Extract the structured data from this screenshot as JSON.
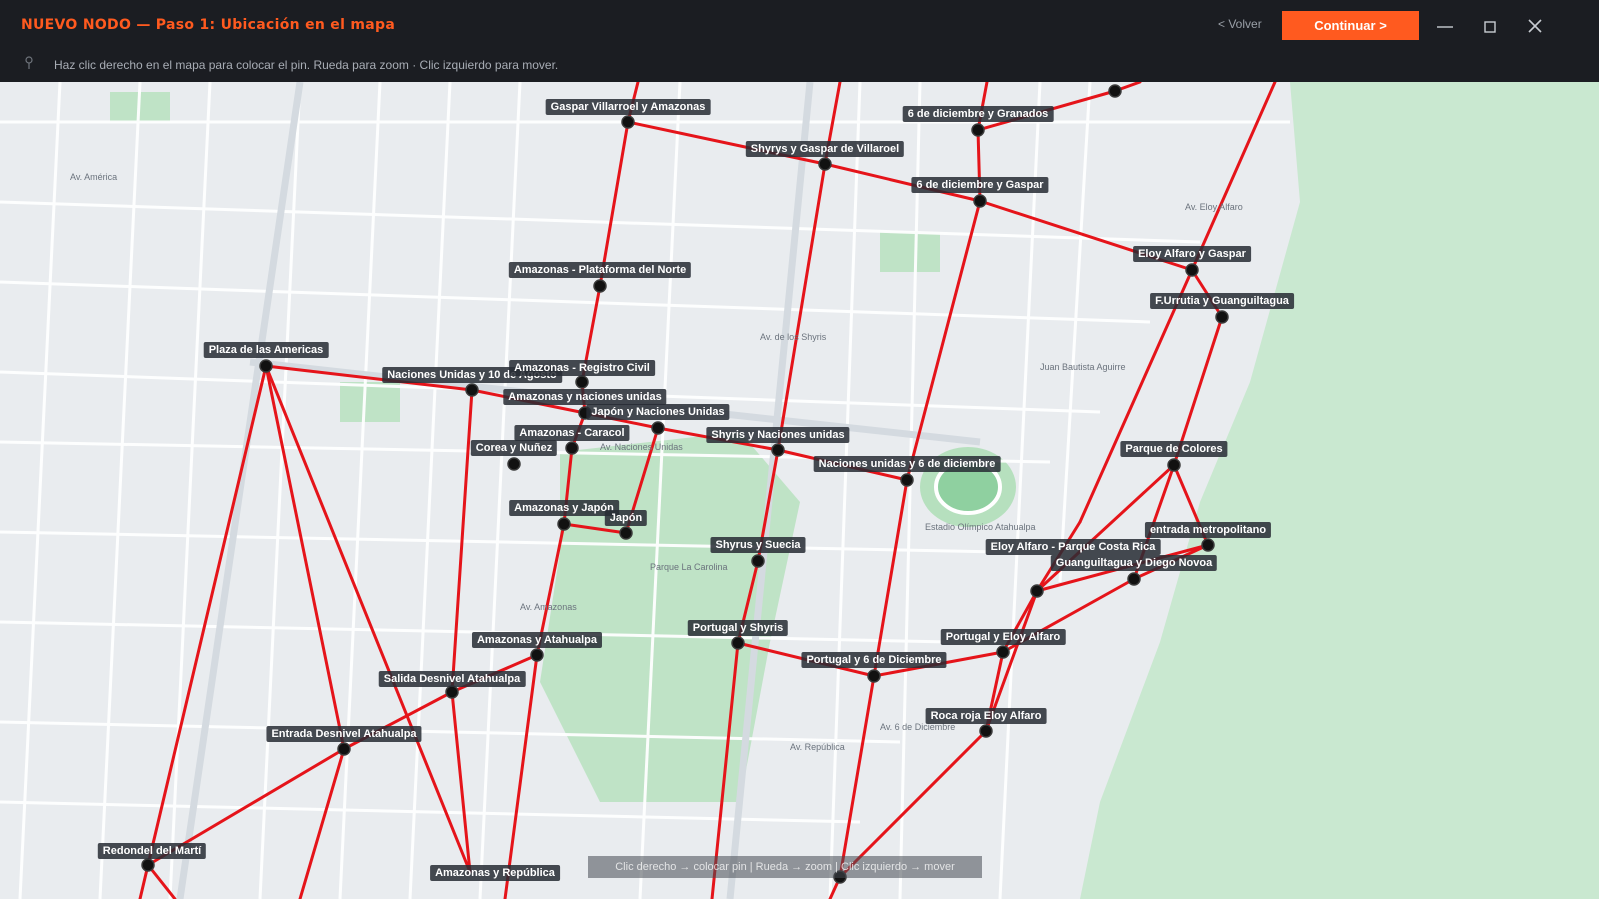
{
  "window": {
    "title": "NUEVO NODO — Paso 1: Ubicación en el mapa",
    "back_label": "< Volver",
    "continue_label": "Continuar >",
    "minimize_icon": "minimize-icon",
    "maximize_icon": "maximize-icon",
    "close_icon": "close-icon"
  },
  "hint": {
    "icon": "pin-icon",
    "text": "Haz clic derecho en el mapa para colocar el pin. Rueda para zoom · Clic izquierdo para mover."
  },
  "map": {
    "bottom_hint": "Clic derecho → colocar pin  |  Rueda → zoom  |  Clic izquierdo → mover",
    "colors": {
      "route": "#e5141a",
      "node": "#111111",
      "park": "#bfe3c6",
      "road": "#ffffff",
      "background": "#e9ecef"
    },
    "nodes": [
      {
        "id": "gaspar_villarroel_amazonas",
        "label": "Gaspar Villarroel y Amazonas"
      },
      {
        "id": "6dic_granados",
        "label": "6 de diciembre y Granados"
      },
      {
        "id": "shyris_gaspar",
        "label": "Shyrys y Gaspar de Villaroel"
      },
      {
        "id": "6dic_gaspar",
        "label": "6 de diciembre y Gaspar"
      },
      {
        "id": "eloy_gaspar",
        "label": "Eloy Alfaro y Gaspar"
      },
      {
        "id": "amazonas_plataforma",
        "label": "Amazonas - Plataforma del Norte"
      },
      {
        "id": "urrutia_guanguiltagua",
        "label": "F.Urrutia y Guanguiltagua"
      },
      {
        "id": "plaza_americas",
        "label": "Plaza de las Americas"
      },
      {
        "id": "nnuu_10agosto",
        "label": "Naciones Unidas y 10 de Agosto"
      },
      {
        "id": "amazonas_registro",
        "label": "Amazonas - Registro Civil"
      },
      {
        "id": "amazonas_nnuu",
        "label": "Amazonas y naciones unidas"
      },
      {
        "id": "japon_nnuu",
        "label": "Japón y Naciones Unidas"
      },
      {
        "id": "amazonas_caracol",
        "label": "Amazonas - Caracol"
      },
      {
        "id": "shyris_nnuu",
        "label": "Shyris y Naciones unidas"
      },
      {
        "id": "corea_nunez",
        "label": "Corea y Nuñez"
      },
      {
        "id": "parque_colores",
        "label": "Parque de Colores"
      },
      {
        "id": "nnuu_6dic",
        "label": "Naciones unidas y 6 de diciembre"
      },
      {
        "id": "amazonas_japon",
        "label": "Amazonas y Japón"
      },
      {
        "id": "japon",
        "label": "Japón"
      },
      {
        "id": "entrada_metropolitano",
        "label": "entrada metropolitano"
      },
      {
        "id": "shyrus_suecia",
        "label": "Shyrus y Suecia"
      },
      {
        "id": "eloy_costa_rica",
        "label": "Eloy Alfaro - Parque Costa Rica"
      },
      {
        "id": "guanguiltagua_diego",
        "label": "Guanguiltagua y Diego Novoa"
      },
      {
        "id": "portugal_shyris",
        "label": "Portugal y Shyris"
      },
      {
        "id": "amazonas_atahualpa",
        "label": "Amazonas y Atahualpa"
      },
      {
        "id": "portugal_eloy",
        "label": "Portugal y Eloy Alfaro"
      },
      {
        "id": "portugal_6dic",
        "label": "Portugal y 6 de Diciembre"
      },
      {
        "id": "salida_atahualpa",
        "label": "Salida Desnivel Atahualpa"
      },
      {
        "id": "roca_eloy",
        "label": "Roca roja Eloy Alfaro"
      },
      {
        "id": "entrada_atahualpa",
        "label": "Entrada Desnivel Atahualpa"
      },
      {
        "id": "redondel_marti",
        "label": "Redondel del Martí"
      },
      {
        "id": "amazonas_republica",
        "label": "Amazonas y República"
      }
    ],
    "place_labels": [
      "Av. América",
      "Av. Amazonas",
      "Av. 6 de Diciembre",
      "Av. Eloy Alfaro",
      "Av. de los Shyris",
      "Parque La Carolina",
      "Juan Bautista Aguirre",
      "Estadio Olímpico Atahualpa",
      "Av. República",
      "Av. Naciones Unidas"
    ]
  }
}
